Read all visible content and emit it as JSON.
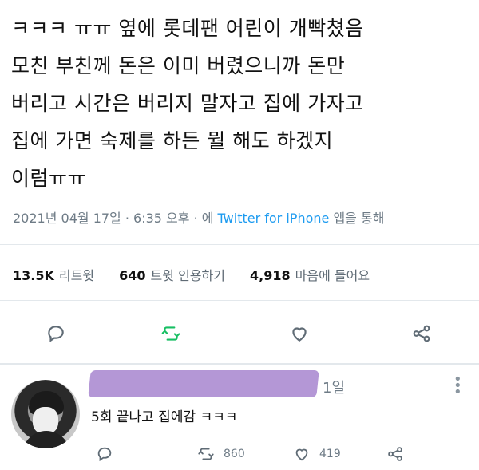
{
  "tweet": {
    "lines": [
      "ㅋㅋㅋ ㅠㅠ 옆에 롯데팬 어린이 개빡쳤음",
      "모친 부친께 돈은 이미 버렸으니까 돈만",
      "버리고 시간은 버리지 말자고 집에 가자고",
      "집에 가면 숙제를 하든 뭘 해도 하겠지",
      "이럼ㅠㅠ"
    ],
    "timestamp": "2021년 04월 17일 · 6:35 오후 · 에 ",
    "source": "Twitter for iPhone",
    "source_suffix": " 앱을 통해"
  },
  "stats": {
    "retweets_count": "13.5K",
    "retweets_label": "리트윗",
    "quotes_count": "640",
    "quotes_label": "트윗 인용하기",
    "likes_count": "4,918",
    "likes_label": "마음에 들어요"
  },
  "actions": {
    "reply_icon": "comment-icon",
    "retweet_icon": "retweet-icon",
    "like_icon": "heart-icon",
    "share_icon": "share-icon"
  },
  "reply": {
    "time": "1일",
    "more": "⋮",
    "text": "5회 끝나고 집에감 ㅋㅋㅋ",
    "retweets": "860",
    "likes": "419"
  },
  "colors": {
    "accent": "#1d9bf0",
    "retweet_green": "#17bf63",
    "icon_gray": "#5f6b75",
    "redaction": "#b497d6"
  }
}
